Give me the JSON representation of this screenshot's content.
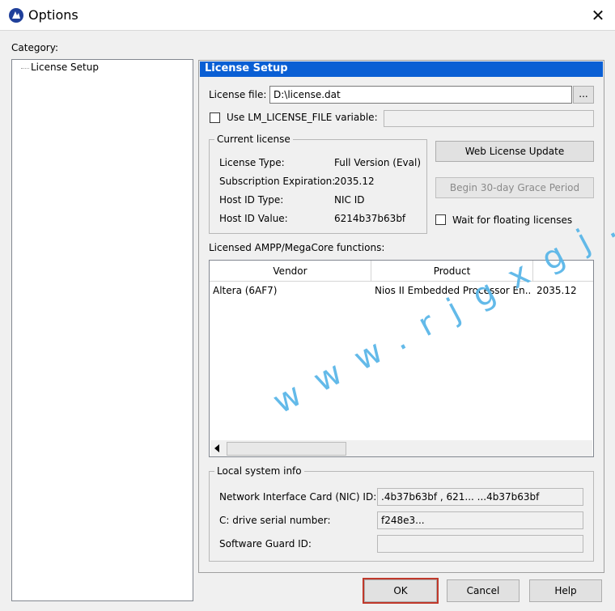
{
  "window": {
    "title": "Options",
    "close_glyph": "✕"
  },
  "category": {
    "label": "Category:",
    "tree_items": [
      "License Setup"
    ]
  },
  "panel": {
    "header": "License Setup",
    "license_file_label": "License file:",
    "license_file_value": "D:\\license.dat",
    "browse_label": "...",
    "use_lm_label": "Use LM_LICENSE_FILE variable:",
    "use_lm_checked": false,
    "use_lm_value": ""
  },
  "current_license": {
    "legend": "Current license",
    "rows": [
      {
        "label": "License Type:",
        "value": "Full Version (Eval)"
      },
      {
        "label": "Subscription Expiration:",
        "value": "2035.12"
      },
      {
        "label": "Host ID Type:",
        "value": "NIC ID"
      },
      {
        "label": "Host ID Value:",
        "value": "6214b37b63bf"
      }
    ]
  },
  "buttons": {
    "web_update": "Web License Update",
    "grace_period": "Begin 30-day Grace Period",
    "wait_floating": "Wait for floating licenses",
    "ok": "OK",
    "cancel": "Cancel",
    "help": "Help"
  },
  "functions": {
    "label": "Licensed AMPP/MegaCore functions:",
    "columns": [
      "Vendor",
      "Product",
      ""
    ],
    "rows": [
      {
        "vendor": "Altera (6AF7)",
        "product": "Nios II Embedded Processor En...",
        "expiry": "2035.12"
      }
    ]
  },
  "local_info": {
    "legend": "Local system info",
    "nic_label": "Network Interface Card (NIC) ID:",
    "nic_value": ".4b37b63bf , 621... ...4b37b63bf",
    "drive_label": "C: drive serial number:",
    "drive_value": "f248e3...",
    "guard_label": "Software Guard ID:",
    "guard_value": ""
  },
  "watermark": "www.rjgxgj.com",
  "colors": {
    "header_bg": "#0a5fd4",
    "watermark": "#5bb7e8",
    "ok_outline": "#c0392b"
  }
}
